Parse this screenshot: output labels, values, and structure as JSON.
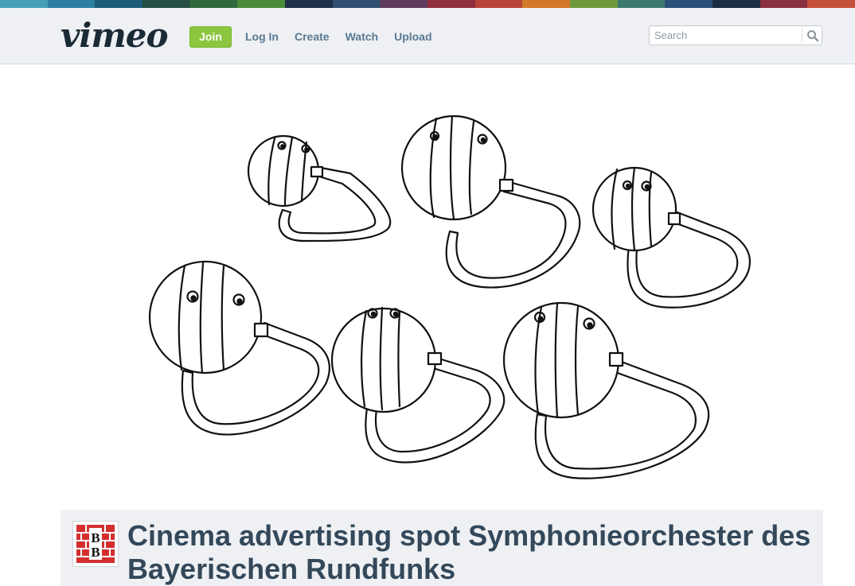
{
  "header": {
    "logo": "vimeo",
    "join_label": "Join",
    "nav": [
      {
        "label": "Log In"
      },
      {
        "label": "Create"
      },
      {
        "label": "Watch"
      },
      {
        "label": "Upload"
      }
    ],
    "search": {
      "placeholder": "Search",
      "value": "",
      "icon": "search-icon"
    }
  },
  "video": {
    "content": "hand-drawn illustration of six round striped figures with cables"
  },
  "clip": {
    "title": "Cinema advertising spot Symphonieorchester des Bayerischen Rundfunks",
    "avatar_letters": "BB"
  },
  "colors": {
    "header_bg": "#eef0f3",
    "join": "#8cc63f",
    "nav_link": "#5a7a93",
    "title": "#33485a",
    "avatar_red": "#d32f2f",
    "strip": [
      "#44a0b8",
      "#2c7fa0",
      "#1b5a78",
      "#254e44",
      "#2f6a3c",
      "#4a8a3b",
      "#1d3048",
      "#2e4f70",
      "#5e3b5e",
      "#8f2f3e",
      "#b8443a",
      "#d27a2a",
      "#6f9a3c",
      "#3d7a6e",
      "#2a4f78",
      "#1c2e44",
      "#8a3040",
      "#c5513b"
    ]
  }
}
